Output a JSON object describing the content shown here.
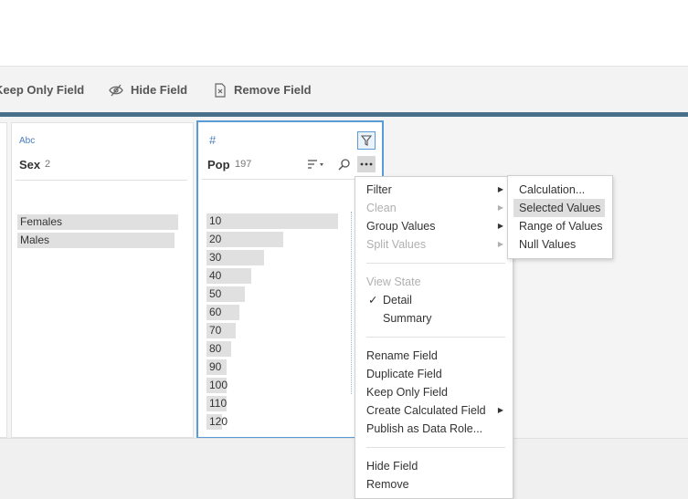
{
  "toolbar": {
    "keep_only": "Keep Only Field",
    "hide": "Hide Field",
    "remove": "Remove Field"
  },
  "sex_card": {
    "type_icon": "Abc",
    "name": "Sex",
    "count": "2",
    "values": [
      {
        "label": "Females",
        "fraction": 1.0
      },
      {
        "label": "Males",
        "fraction": 0.98
      }
    ]
  },
  "pop_card": {
    "type_icon": "#",
    "name": "Pop",
    "count": "197",
    "values": [
      {
        "label": "10",
        "fraction": 1.0
      },
      {
        "label": "20",
        "fraction": 0.58
      },
      {
        "label": "30",
        "fraction": 0.44
      },
      {
        "label": "40",
        "fraction": 0.34
      },
      {
        "label": "50",
        "fraction": 0.29
      },
      {
        "label": "60",
        "fraction": 0.25
      },
      {
        "label": "70",
        "fraction": 0.22
      },
      {
        "label": "80",
        "fraction": 0.19
      },
      {
        "label": "90",
        "fraction": 0.15
      },
      {
        "label": "100",
        "fraction": 0.15
      },
      {
        "label": "110",
        "fraction": 0.15
      },
      {
        "label": "120",
        "fraction": 0.12
      }
    ],
    "icons": [
      "filter-icon",
      "sort-icon",
      "search-icon",
      "more-icon"
    ]
  },
  "context_menu": {
    "filter": "Filter",
    "clean": "Clean",
    "group_values": "Group Values",
    "split_values": "Split Values",
    "view_state": "View State",
    "check": "✓",
    "detail": "Detail",
    "summary": "Summary",
    "rename": "Rename Field",
    "duplicate": "Duplicate Field",
    "keep_only": "Keep Only Field",
    "create_calc": "Create Calculated Field",
    "publish": "Publish as Data Role...",
    "hide": "Hide Field",
    "remove": "Remove"
  },
  "filter_submenu": {
    "calculation": "Calculation...",
    "selected_values": "Selected Values",
    "range_of_values": "Range of Values",
    "null_values": "Null Values"
  },
  "colors": {
    "accent_blue": "#5b9bd5",
    "header_bar": "#4a6f8a",
    "bar_gray": "#e0e0e0",
    "highlight": "#dedede"
  }
}
